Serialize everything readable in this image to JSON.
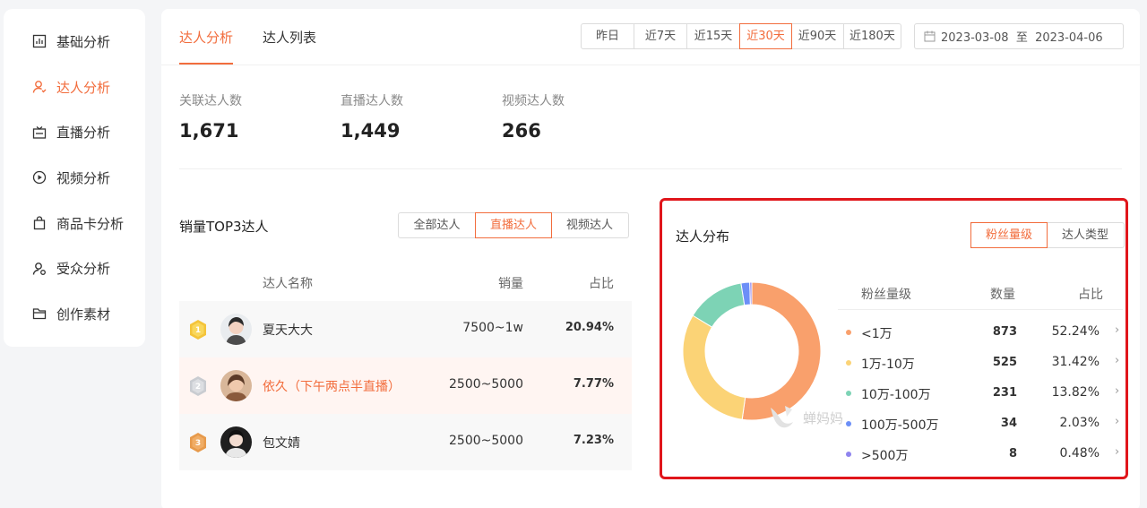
{
  "sidebar": {
    "items": [
      {
        "label": "基础分析",
        "icon": "bar-chart-icon",
        "active": false
      },
      {
        "label": "达人分析",
        "icon": "user-icon",
        "active": true
      },
      {
        "label": "直播分析",
        "icon": "live-tv-icon",
        "active": false
      },
      {
        "label": "视频分析",
        "icon": "play-circle-icon",
        "active": false
      },
      {
        "label": "商品卡分析",
        "icon": "shopping-bag-icon",
        "active": false
      },
      {
        "label": "受众分析",
        "icon": "audience-icon",
        "active": false
      },
      {
        "label": "创作素材",
        "icon": "folder-icon",
        "active": false
      }
    ]
  },
  "header": {
    "tabs": [
      {
        "label": "达人分析",
        "active": true
      },
      {
        "label": "达人列表",
        "active": false
      }
    ],
    "ranges": [
      {
        "label": "昨日",
        "active": false
      },
      {
        "label": "近7天",
        "active": false
      },
      {
        "label": "近15天",
        "active": false
      },
      {
        "label": "近30天",
        "active": true
      },
      {
        "label": "近90天",
        "active": false
      },
      {
        "label": "近180天",
        "active": false
      }
    ],
    "date_range": "2023-03-08  至  2023-04-06"
  },
  "stats": [
    {
      "label": "关联达人数",
      "value": "1,671"
    },
    {
      "label": "直播达人数",
      "value": "1,449"
    },
    {
      "label": "视频达人数",
      "value": "266"
    }
  ],
  "top3": {
    "title": "销量TOP3达人",
    "filters": [
      {
        "label": "全部达人",
        "active": false
      },
      {
        "label": "直播达人",
        "active": true
      },
      {
        "label": "视频达人",
        "active": false
      }
    ],
    "headers": {
      "name": "达人名称",
      "sales": "销量",
      "share": "占比"
    },
    "rows": [
      {
        "rank": "1",
        "name": "夏天大大",
        "sales": "7500~1w",
        "share": "20.94%"
      },
      {
        "rank": "2",
        "name": "依久（下午两点半直播）",
        "sales": "2500~5000",
        "share": "7.77%"
      },
      {
        "rank": "3",
        "name": "包文婧",
        "sales": "2500~5000",
        "share": "7.23%"
      }
    ]
  },
  "distribution": {
    "title": "达人分布",
    "toggles": [
      {
        "label": "粉丝量级",
        "active": true
      },
      {
        "label": "达人类型",
        "active": false
      }
    ],
    "headers": {
      "level": "粉丝量级",
      "count": "数量",
      "share": "占比"
    },
    "watermark": "蝉妈妈",
    "colors": {
      "lt1w": "#f9a06c",
      "w1_10": "#fbd376",
      "w10_100": "#7dd3b5",
      "w100_500": "#6c8ff7",
      "gt500": "#8f84ee"
    },
    "rows": [
      {
        "label": "<1万",
        "count": "873",
        "share": "52.24%",
        "color": "#f9a06c"
      },
      {
        "label": "1万-10万",
        "count": "525",
        "share": "31.42%",
        "color": "#fbd376"
      },
      {
        "label": "10万-100万",
        "count": "231",
        "share": "13.82%",
        "color": "#7dd3b5"
      },
      {
        "label": "100万-500万",
        "count": "34",
        "share": "2.03%",
        "color": "#6c8ff7"
      },
      {
        "label": ">500万",
        "count": "8",
        "share": "0.48%",
        "color": "#8f84ee"
      }
    ]
  },
  "chart_data": {
    "type": "pie",
    "categories": [
      "<1万",
      "1万-10万",
      "10万-100万",
      "100万-500万",
      ">500万"
    ],
    "values": [
      873,
      525,
      231,
      34,
      8
    ],
    "title": "",
    "donut": true
  }
}
